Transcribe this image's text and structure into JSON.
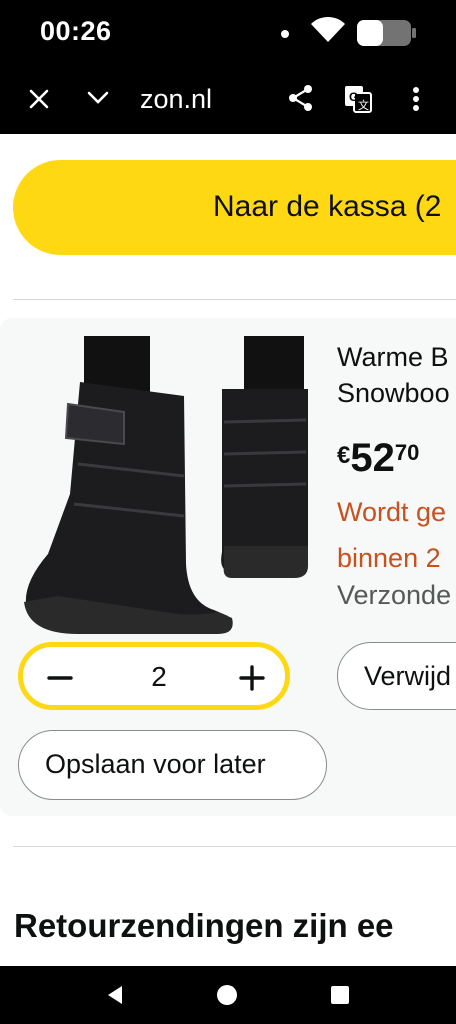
{
  "status_bar": {
    "time": "00:26"
  },
  "browser": {
    "url": "zon.nl"
  },
  "cart": {
    "checkout_label": "Naar de kassa (2",
    "item": {
      "title_line1": "Warme B",
      "title_line2": "Snowboo",
      "price_currency": "€",
      "price_whole": "52",
      "price_fraction": "70",
      "delivery_line1": "Wordt ge",
      "delivery_line2": "binnen 2",
      "shipped": "Verzonde",
      "quantity": "2",
      "remove_label": "Verwijd",
      "save_later_label": "Opslaan voor later"
    },
    "returns_heading": "Retourzendingen zijn ee"
  },
  "colors": {
    "accent_yellow": "#ffd814",
    "delivery_orange": "#c7511f"
  },
  "icons": [
    "close-icon",
    "chevron-down-icon",
    "share-icon",
    "translate-icon",
    "more-vert-icon",
    "minus-icon",
    "plus-icon",
    "back-icon",
    "home-icon",
    "recents-icon",
    "wifi-icon",
    "battery-icon"
  ]
}
